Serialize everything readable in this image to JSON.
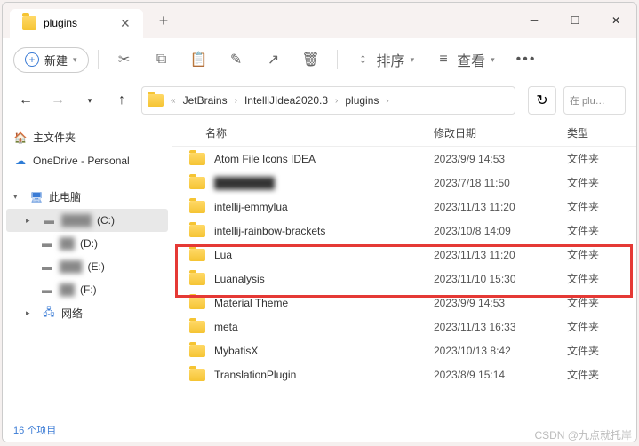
{
  "title": "plugins",
  "toolbar": {
    "new_label": "新建",
    "sort_label": "排序",
    "view_label": "查看"
  },
  "breadcrumb": [
    "JetBrains",
    "IntelliJIdea2020.3",
    "plugins"
  ],
  "search_placeholder": "在 plu…",
  "sidebar": {
    "home": "主文件夹",
    "onedrive": "OneDrive - Personal",
    "thispc": "此电脑",
    "drives": [
      "(C:)",
      "(D:)",
      "(E:)",
      "(F:)"
    ],
    "network": "网络"
  },
  "columns": {
    "name": "名称",
    "date": "修改日期",
    "type": "类型"
  },
  "rows": [
    {
      "name": "Atom File Icons IDEA",
      "date": "2023/9/9 14:53",
      "type": "文件夹"
    },
    {
      "name": "",
      "date": "2023/7/18 11:50",
      "type": "文件夹",
      "blur": true
    },
    {
      "name": "intellij-emmylua",
      "date": "2023/11/13 11:20",
      "type": "文件夹"
    },
    {
      "name": "intellij-rainbow-brackets",
      "date": "2023/10/8 14:09",
      "type": "文件夹"
    },
    {
      "name": "Lua",
      "date": "2023/11/13 11:20",
      "type": "文件夹"
    },
    {
      "name": "Luanalysis",
      "date": "2023/11/10 15:30",
      "type": "文件夹"
    },
    {
      "name": "Material Theme",
      "date": "2023/9/9 14:53",
      "type": "文件夹"
    },
    {
      "name": "meta",
      "date": "2023/11/13 16:33",
      "type": "文件夹"
    },
    {
      "name": "MybatisX",
      "date": "2023/10/13 8:42",
      "type": "文件夹"
    },
    {
      "name": "TranslationPlugin",
      "date": "2023/8/9 15:14",
      "type": "文件夹"
    }
  ],
  "highlight": {
    "start": 4,
    "end": 5
  },
  "status": "16 个项目",
  "watermark": "CSDN @九点就托岸"
}
